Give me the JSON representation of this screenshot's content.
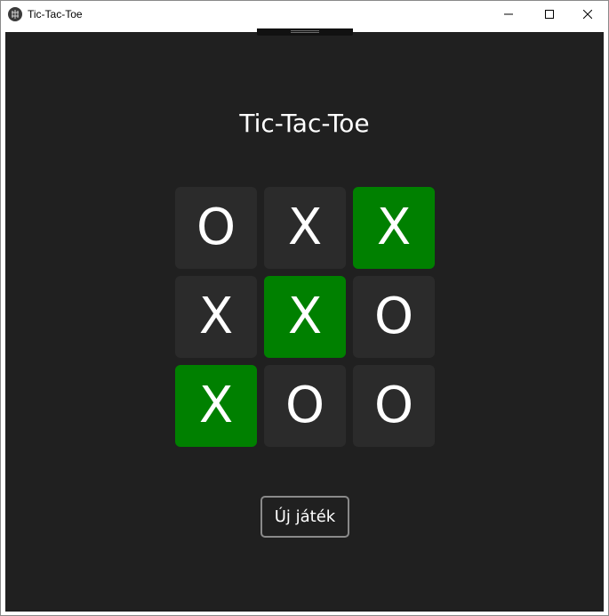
{
  "window": {
    "title": "Tic-Tac-Toe",
    "icon": "app-icon",
    "controls": [
      "minimize-icon",
      "maximize-icon",
      "close-icon"
    ]
  },
  "game": {
    "title": "Tic-Tac-Toe",
    "board": [
      {
        "value": "O",
        "winning": false
      },
      {
        "value": "X",
        "winning": false
      },
      {
        "value": "X",
        "winning": true
      },
      {
        "value": "X",
        "winning": false
      },
      {
        "value": "X",
        "winning": true
      },
      {
        "value": "O",
        "winning": false
      },
      {
        "value": "X",
        "winning": true
      },
      {
        "value": "O",
        "winning": false
      },
      {
        "value": "O",
        "winning": false
      }
    ],
    "new_game_label": "Új játék"
  },
  "colors": {
    "background": "#202020",
    "cell": "#2b2b2b",
    "winning_cell": "#008000",
    "text": "#ffffff"
  }
}
